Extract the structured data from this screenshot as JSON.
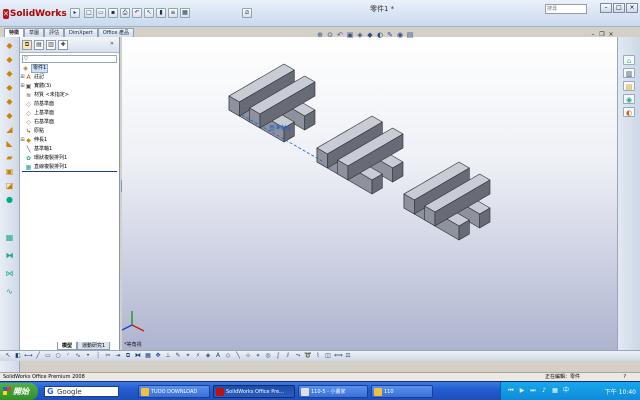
{
  "app": {
    "name": "SolidWorks",
    "doc_title": "零件1 *",
    "search_placeholder": "搜尋"
  },
  "command_tabs": [
    "特徵",
    "草圖",
    "評估",
    "DimXpert",
    "Office 產品"
  ],
  "feature_tree": {
    "nodes": [
      {
        "label": "零件1",
        "icon": "part-icon",
        "highlight": true
      },
      {
        "label": "註記",
        "icon": "annotation-icon"
      },
      {
        "label": "實體(3)",
        "icon": "solid-bodies-icon"
      },
      {
        "label": "材質 <未指定>",
        "icon": "material-icon"
      },
      {
        "label": "前基準面",
        "icon": "plane-icon"
      },
      {
        "label": "上基準面",
        "icon": "plane-icon"
      },
      {
        "label": "右基準面",
        "icon": "plane-icon"
      },
      {
        "label": "原點",
        "icon": "origin-icon"
      },
      {
        "label": "伸長1",
        "icon": "extrude-icon"
      },
      {
        "label": "基準軸1",
        "icon": "axis-icon"
      },
      {
        "label": "環狀複製排列1",
        "icon": "circular-pattern-icon"
      },
      {
        "label": "直線複製排列1",
        "icon": "linear-pattern-icon"
      }
    ],
    "bottom_tabs": [
      "模型",
      "運動研究1"
    ]
  },
  "viewport": {
    "dimension_label": "基準軸1",
    "view_label": "*等角視"
  },
  "statusbar": {
    "left": "SolidWorks Office Premium 2008",
    "edit_state": "正在編輯：零件",
    "question": "?"
  },
  "taskbar": {
    "start": "開始",
    "google": "Google",
    "tasks": [
      {
        "label": "TUDO DOWNLOAD",
        "active": false
      },
      {
        "label": "SolidWorks Office Pre...",
        "active": true
      },
      {
        "label": "110-5 - 小畫家",
        "active": false
      },
      {
        "label": "110",
        "active": false
      }
    ],
    "clock": "下午 10:40"
  },
  "colors": {
    "part_face": "#c9ccd4",
    "part_side": "#8e929c",
    "part_dark": "#676b75",
    "edge": "#2b2d33",
    "selection": "#2060d0"
  }
}
